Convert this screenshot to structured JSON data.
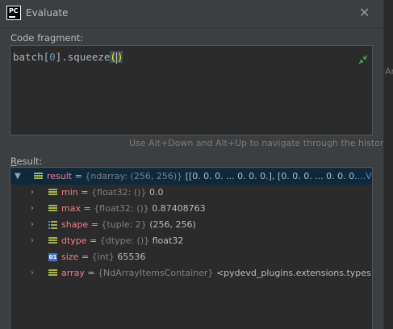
{
  "window": {
    "title": "Evaluate"
  },
  "labels": {
    "code_fragment": "Code fragment:",
    "result_prefix": "R",
    "result_rest": "esult:"
  },
  "editor": {
    "segments": [
      "batch[",
      "0",
      "].squeeze",
      "(",
      ")"
    ]
  },
  "hint": "Use Alt+Down and Alt+Up to navigate through the history",
  "result_row": {
    "name": "result",
    "type": "{ndarray: (256, 256)}",
    "value": "[[0. 0. 0. ... 0. 0. 0.], [0. 0. 0. ... 0. 0. 0.",
    "link": "...View as Array"
  },
  "children": [
    {
      "name": "min",
      "type": "{float32: ()}",
      "value": "0.0",
      "icon": "field-icon"
    },
    {
      "name": "max",
      "type": "{float32: ()}",
      "value": "0.87408763",
      "icon": "field-icon"
    },
    {
      "name": "shape",
      "type": "{tuple: 2}",
      "value": "(256, 256)",
      "icon": "list-icon"
    },
    {
      "name": "dtype",
      "type": "{dtype: ()}",
      "value": "float32",
      "icon": "field-icon"
    },
    {
      "name": "size",
      "type": "{int}",
      "value": "65536",
      "icon": "int-icon"
    },
    {
      "name": "array",
      "type": "{NdArrayItemsContainer}",
      "value": "<pydevd_plugins.extensions.types.pyde",
      "icon": "field-icon"
    }
  ],
  "side_strip_text": "Arra",
  "colors": {
    "background": "#3c3f41",
    "editor": "#2b2b2b",
    "name": "#f47e8a",
    "link": "#5a8bd6",
    "selection": "#0d293e"
  }
}
